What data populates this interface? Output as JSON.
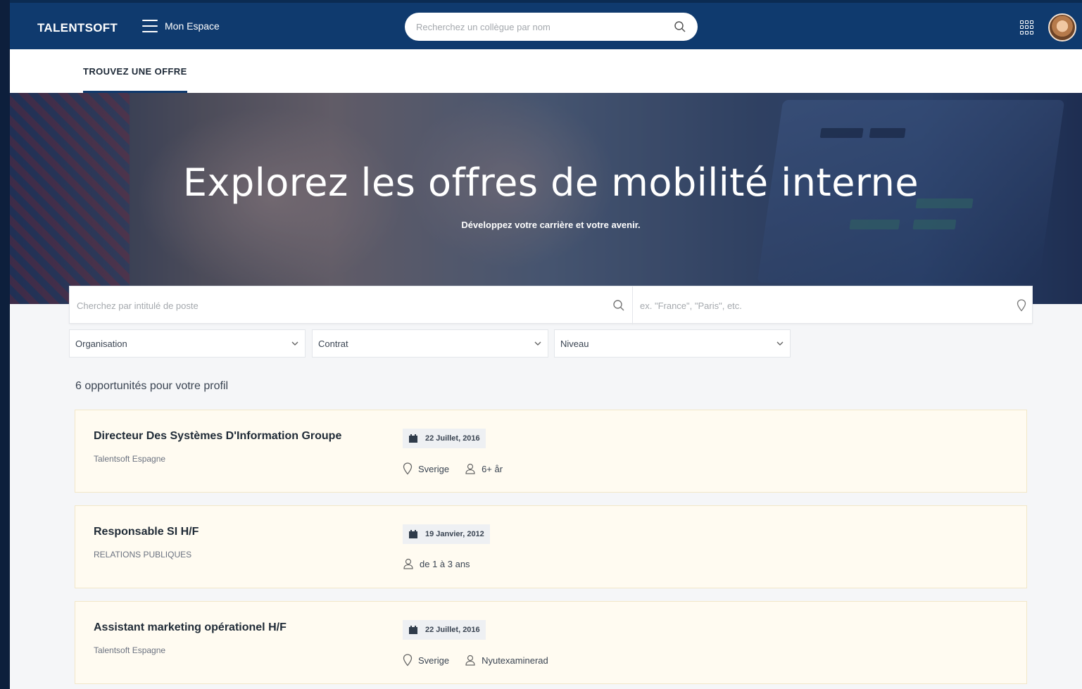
{
  "header": {
    "logo": "TALENTSOFT",
    "menu_label": "Mon Espace",
    "search_placeholder": "Recherchez un collègue par nom"
  },
  "tabs": [
    {
      "label": "TROUVEZ UNE OFFRE",
      "active": true
    }
  ],
  "hero": {
    "title": "Explorez les offres de mobilité interne",
    "subtitle": "Développez votre carrière et votre avenir."
  },
  "search": {
    "job_placeholder": "Cherchez par intitulé de poste",
    "location_placeholder": "ex. \"France\", \"Paris\", etc."
  },
  "filters": [
    {
      "label": "Organisation"
    },
    {
      "label": "Contrat"
    },
    {
      "label": "Niveau"
    }
  ],
  "results_count": "6 opportunités pour votre profil",
  "jobs": [
    {
      "title": "Directeur Des Systèmes D'Information Groupe",
      "organization": "Talentsoft Espagne",
      "date": "22 Juillet, 2016",
      "location": "Sverige",
      "experience": "6+ år"
    },
    {
      "title": "Responsable SI H/F",
      "organization": "RELATIONS PUBLIQUES",
      "date": "19 Janvier, 2012",
      "location": "",
      "experience": "de 1 à 3 ans"
    },
    {
      "title": "Assistant marketing opérationel H/F",
      "organization": "Talentsoft Espagne",
      "date": "22 Juillet, 2016",
      "location": "Sverige",
      "experience": "Nyutexaminerad"
    }
  ],
  "colors": {
    "navbar": "#0f3a6e",
    "card_bg": "#fffbf1",
    "card_border": "#f2e7c8",
    "page_bg": "#f5f6f8"
  },
  "icons": [
    "menu-icon",
    "search-icon",
    "apps-grid-icon",
    "avatar",
    "location-pin-icon",
    "chevron-down-icon",
    "calendar-icon",
    "user-icon"
  ]
}
